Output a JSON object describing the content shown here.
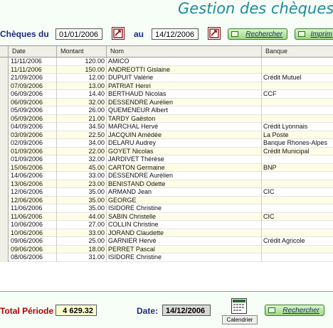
{
  "title": "Gestion des chèques",
  "filter": {
    "cheques_label": "Chèques  du",
    "date_from": "01/01/2006",
    "au_label": "au",
    "date_to": "14/12/2006",
    "search_label": "Rechercher",
    "print_label": "Imprim"
  },
  "table": {
    "headers": [
      "Date",
      "Montant",
      "Nom",
      "Banque"
    ],
    "rows": [
      [
        "11/11/2006",
        "120.00",
        "AMICO",
        ""
      ],
      [
        "11/11/2006",
        "150.00",
        "ANDREOTTI Gislaine",
        ""
      ],
      [
        "21/09/2006",
        "12.00",
        "DUPUIT Valérie",
        "Crédit Mutuel"
      ],
      [
        "07/09/2006",
        "13.00",
        "PATRIAT Henri",
        ""
      ],
      [
        "06/09/2006",
        "14.40",
        "BERTHAUD Nicolas",
        "CCF"
      ],
      [
        "06/09/2006",
        "32.00",
        "DESSENDRE Aurélien",
        ""
      ],
      [
        "05/09/2006",
        "26.00",
        "QUEMENEUR Albert",
        ""
      ],
      [
        "05/09/2006",
        "21.00",
        "TARDY Gaëston",
        ""
      ],
      [
        "04/09/2006",
        "34.50",
        "MARCHAL Hervé",
        "Crédit Lyonnais"
      ],
      [
        "03/09/2006",
        "22.50",
        "JACQUIN Amédée",
        "La Poste"
      ],
      [
        "02/09/2006",
        "34.00",
        "DELARU Audrey",
        "Banque Rhones-Alpes"
      ],
      [
        "01/09/2006",
        "22.00",
        "GOYET Nicolas",
        "Crédit Municipal"
      ],
      [
        "01/09/2006",
        "32.00",
        "JARDIVET Thérèse",
        ""
      ],
      [
        "15/06/2006",
        "45.00",
        "CARTON Germaine",
        "BNP"
      ],
      [
        "14/06/2006",
        "33.00",
        "DESSENDRE Aurélien",
        ""
      ],
      [
        "13/06/2006",
        "23.00",
        "BENISTAND Odette",
        ""
      ],
      [
        "12/06/2006",
        "35.00",
        "ARMAND Jean",
        "CIC"
      ],
      [
        "12/06/2006",
        "35.00",
        "GEORGE",
        ""
      ],
      [
        "11/06/2006",
        "35.00",
        "ISIDORE Christine",
        ""
      ],
      [
        "11/06/2006",
        "44.00",
        "SABIN Christelle",
        "CIC"
      ],
      [
        "10/06/2006",
        "27.00",
        "COLLIN Christine",
        ""
      ],
      [
        "10/06/2006",
        "33.00",
        "JORAND Claudette",
        ""
      ],
      [
        "09/06/2006",
        "25.00",
        "GARNIER Hervé",
        "Crédit Agricole"
      ],
      [
        "09/06/2006",
        "18.00",
        "PERRET Pascal",
        ""
      ],
      [
        "08/06/2006",
        "31.00",
        "ISIDORE Christine",
        ""
      ]
    ]
  },
  "footer": {
    "total_label": "Total Période :",
    "total_value": "4 629.32",
    "date_label": "Date:",
    "date_value": "14/12/2006",
    "calendar_label": "Calendrier",
    "search_label": "Rechercher"
  },
  "colors": {
    "accent": "#1b8a9e",
    "label": "#1c2a86",
    "total_label": "#b00000",
    "row_alt": "#fefde6",
    "button": "#9ed883"
  }
}
